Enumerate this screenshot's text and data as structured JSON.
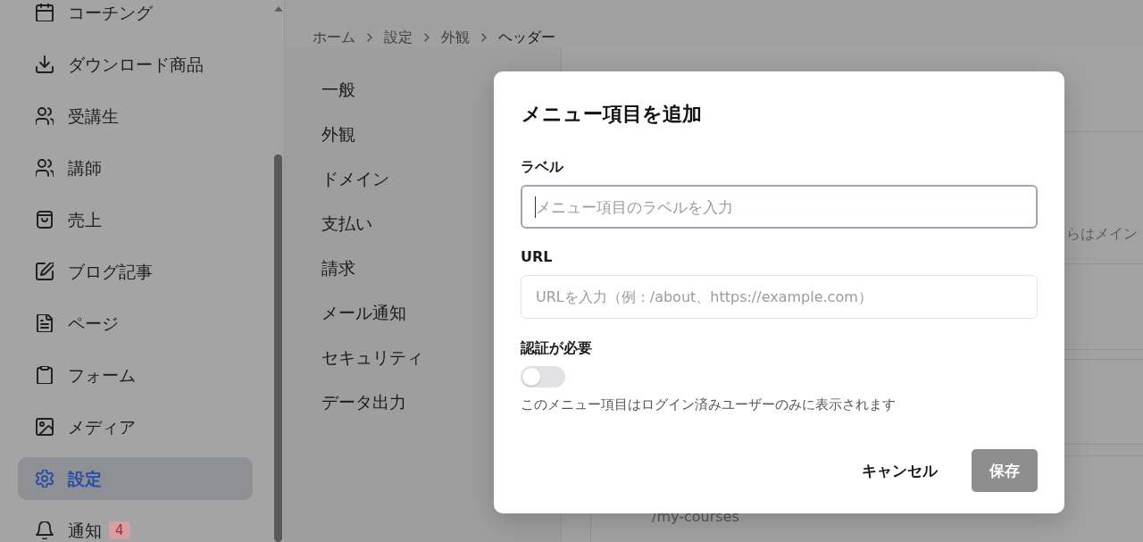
{
  "sidebar": {
    "items": [
      {
        "label": "コーチング",
        "selected": false
      },
      {
        "label": "ダウンロード商品",
        "selected": false
      },
      {
        "label": "受講生",
        "selected": false
      },
      {
        "label": "講師",
        "selected": false
      },
      {
        "label": "売上",
        "selected": false
      },
      {
        "label": "ブログ記事",
        "selected": false
      },
      {
        "label": "ページ",
        "selected": false
      },
      {
        "label": "フォーム",
        "selected": false
      },
      {
        "label": "メディア",
        "selected": false
      },
      {
        "label": "設定",
        "selected": true
      },
      {
        "label": "通知",
        "selected": false,
        "badge": "4"
      }
    ]
  },
  "breadcrumb": [
    {
      "label": "ホーム",
      "current": false
    },
    {
      "label": "設定",
      "current": false
    },
    {
      "label": "外観",
      "current": false
    },
    {
      "label": "ヘッダー",
      "current": true
    }
  ],
  "settings_nav": {
    "items": [
      "一般",
      "外観",
      "ドメイン",
      "支払い",
      "請求",
      "メール通知",
      "セキュリティ",
      "データ出力"
    ]
  },
  "content_panel": {
    "description": "らはメイン",
    "menu_item_url": "/my-courses"
  },
  "dialog": {
    "title": "メニュー項目を追加",
    "fields": [
      {
        "label": "ラベル",
        "placeholder": "メニュー項目のラベルを入力",
        "focused": true
      },
      {
        "label": "URL",
        "placeholder": "URLを入力（例：/about、https://example.com）",
        "focused": false
      }
    ],
    "auth": {
      "label": "認証が必要",
      "on": false,
      "help": "このメニュー項目はログイン済みユーザーのみに表示されます"
    },
    "buttons": [
      {
        "label": "キャンセル",
        "kind": "text",
        "disabled": false
      },
      {
        "label": "保存",
        "kind": "primary",
        "disabled": true
      }
    ]
  }
}
